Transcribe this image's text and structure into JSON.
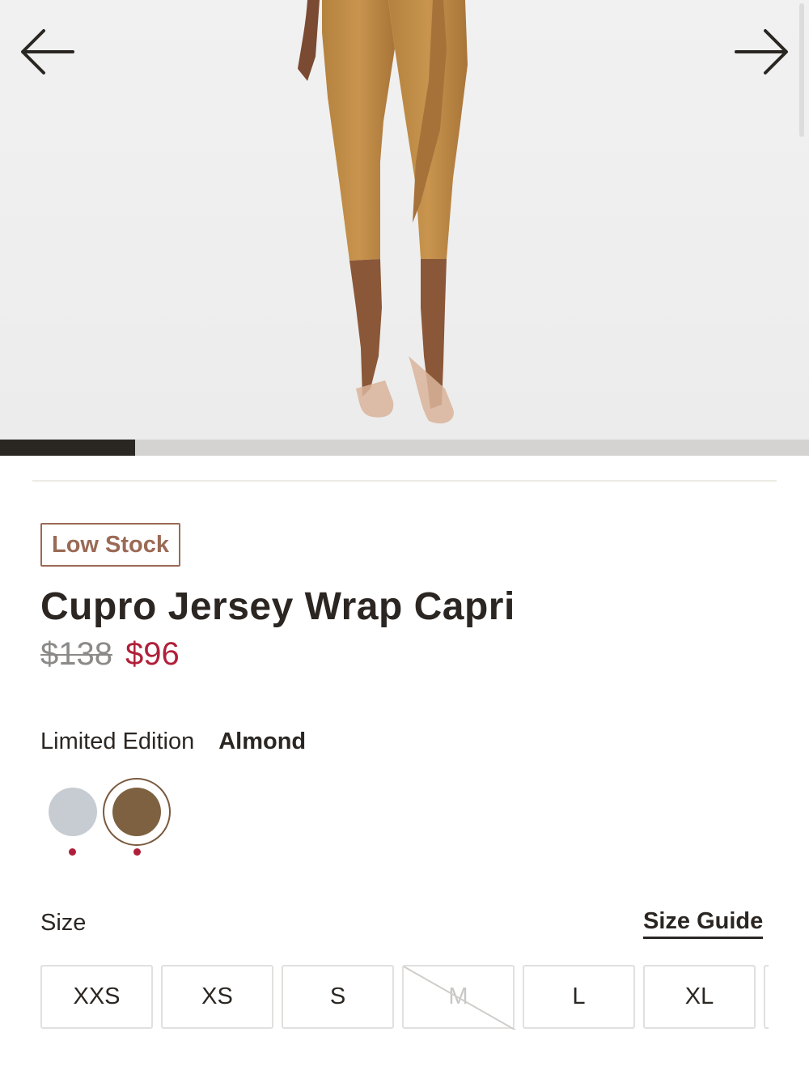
{
  "gallery": {
    "prev_icon": "arrow-left-icon",
    "next_icon": "arrow-right-icon",
    "progress_fraction": 0.167
  },
  "product": {
    "badge": "Low Stock",
    "title": "Cupro Jersey Wrap Capri",
    "price_original": "$138",
    "price_sale": "$96",
    "price_sale_color": "#b01f3a",
    "color_label": "Limited Edition",
    "color_name": "Almond",
    "swatches": [
      {
        "color": "#c6ccd2",
        "selected": false
      },
      {
        "color": "#7e6141",
        "selected": true
      }
    ]
  },
  "sizes": {
    "label": "Size",
    "guide": "Size Guide",
    "options": [
      {
        "label": "XXS",
        "available": true
      },
      {
        "label": "XS",
        "available": true
      },
      {
        "label": "S",
        "available": true
      },
      {
        "label": "M",
        "available": false
      },
      {
        "label": "L",
        "available": true
      },
      {
        "label": "XL",
        "available": true
      }
    ]
  }
}
